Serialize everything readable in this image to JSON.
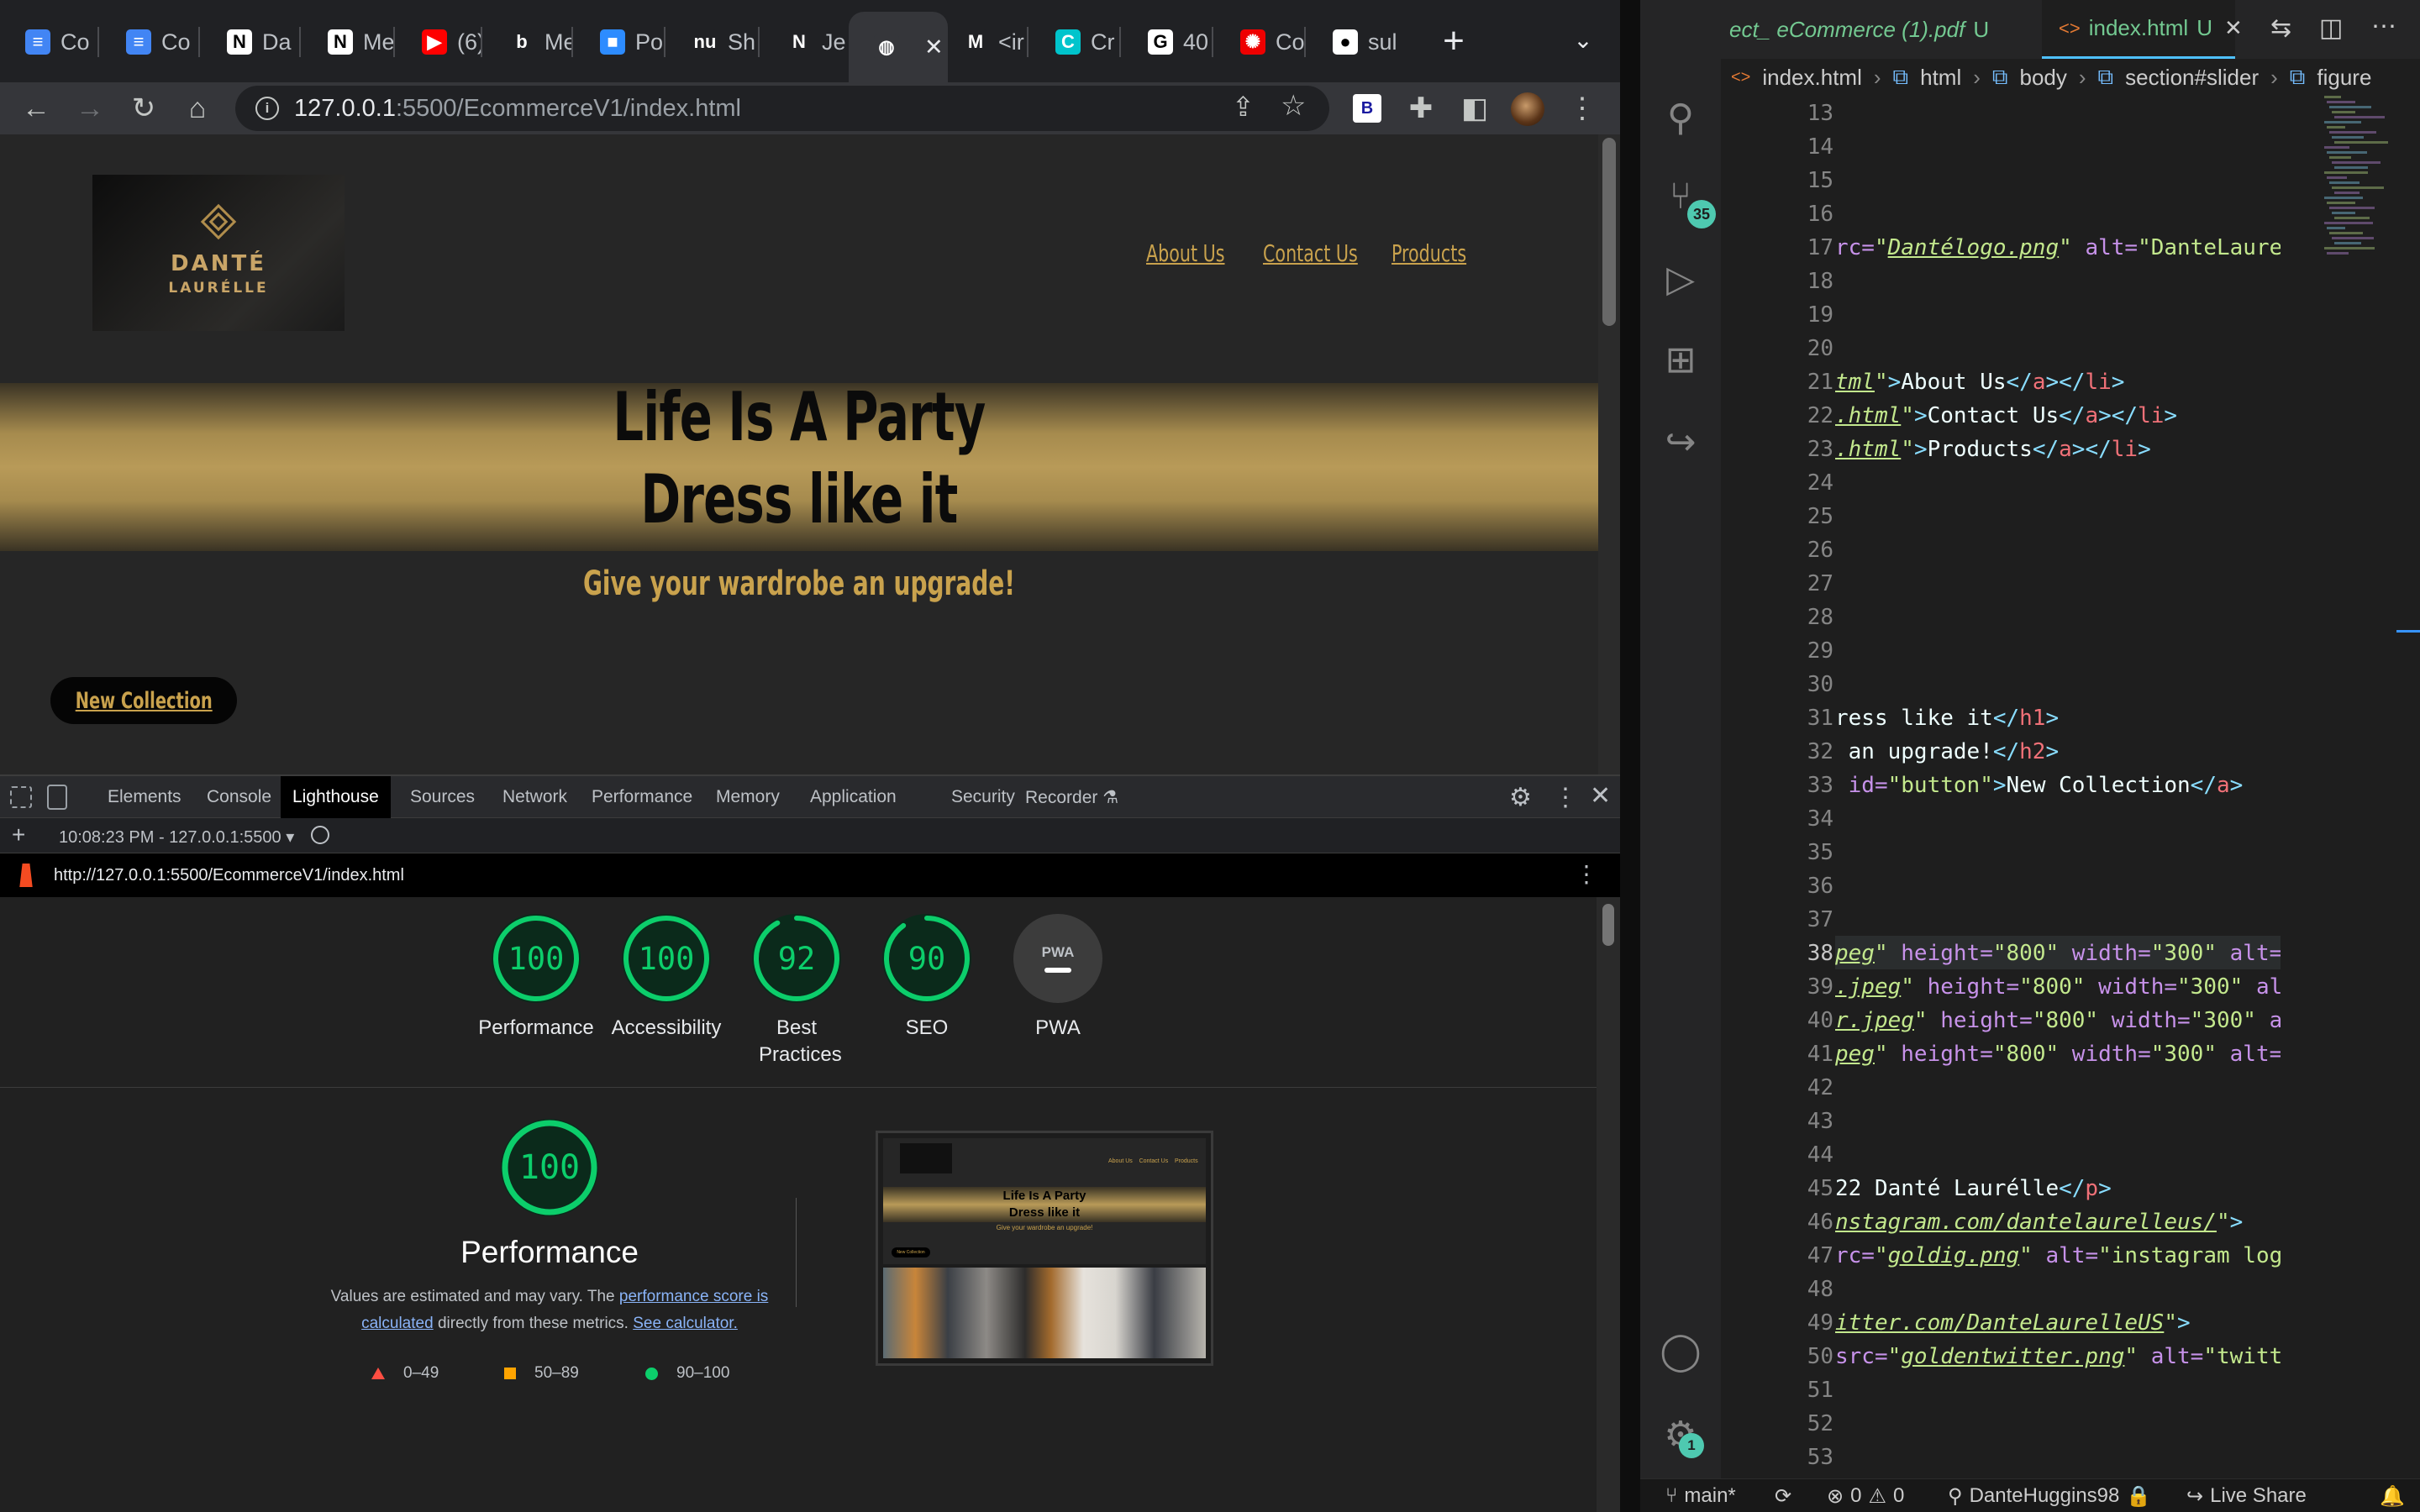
{
  "chrome": {
    "tabs": [
      {
        "label": "Co",
        "icon": "google-docs-icon",
        "color": "#4285f4",
        "glyph": "≡"
      },
      {
        "label": "Co",
        "icon": "google-docs-icon",
        "color": "#4285f4",
        "glyph": "≡"
      },
      {
        "label": "Da",
        "icon": "notion-icon",
        "color": "#ffffff",
        "glyph": "N"
      },
      {
        "label": "Me",
        "icon": "notion-icon",
        "color": "#ffffff",
        "glyph": "N"
      },
      {
        "label": "(6)",
        "icon": "youtube-icon",
        "color": "#ff0000",
        "glyph": "▶"
      },
      {
        "label": "Me",
        "icon": "b-icon",
        "color": "#202124",
        "glyph": "b"
      },
      {
        "label": "Po",
        "icon": "zoom-icon",
        "color": "#2d8cff",
        "glyph": "■"
      },
      {
        "label": "Sh",
        "icon": "nu-icon",
        "color": "#202124",
        "glyph": "nu"
      },
      {
        "label": "Jev",
        "icon": "nm-icon",
        "color": "#202124",
        "glyph": "N"
      },
      {
        "label": "",
        "icon": "globe-icon",
        "color": "#35363a",
        "glyph": "◍",
        "active": true
      },
      {
        "label": "<ir",
        "icon": "m-icon",
        "color": "#202124",
        "glyph": "M"
      },
      {
        "label": "Cr",
        "icon": "canva-icon",
        "color": "#00c4cc",
        "glyph": "C"
      },
      {
        "label": "40",
        "icon": "google-icon",
        "color": "#ffffff",
        "glyph": "G"
      },
      {
        "label": "Co",
        "icon": "redhat-icon",
        "color": "#ee0000",
        "glyph": "✺"
      },
      {
        "label": "sul",
        "icon": "github-icon",
        "color": "#ffffff",
        "glyph": "●"
      }
    ],
    "new_tab": "+",
    "url_host": "127.0.0.1",
    "url_rest": ":5500/EcommerceV1/index.html",
    "extension_b": "B"
  },
  "site": {
    "logo_line1": "DANTÉ",
    "logo_line2": "LAURÉLLE",
    "nav": [
      "About Us",
      "Contact Us",
      "Products"
    ],
    "hero_line1": "Life Is A Party",
    "hero_line2": "Dress like it",
    "subtitle": "Give your wardrobe an upgrade!",
    "cta": "New Collection"
  },
  "devtools": {
    "tabs": [
      "Elements",
      "Console",
      "Lighthouse",
      "Sources",
      "Network",
      "Performance",
      "Memory",
      "Application",
      "Security",
      "Recorder ⚗"
    ],
    "active_tab": "Lighthouse",
    "report_time": "10:08:23 PM - 127.0.0.1:5500 ▾",
    "report_url": "http://127.0.0.1:5500/EcommerceV1/index.html",
    "scores": [
      {
        "label": "Performance",
        "value": "100",
        "fraction": 1.0
      },
      {
        "label": "Accessibility",
        "value": "100",
        "fraction": 1.0
      },
      {
        "label": "Best Practices",
        "value": "92",
        "fraction": 0.92
      },
      {
        "label": "SEO",
        "value": "90",
        "fraction": 0.9
      },
      {
        "label": "PWA",
        "value": "PWA",
        "fraction": 0
      }
    ],
    "perf_score": "100",
    "perf_title": "Performance",
    "perf_desc_1": "Values are estimated and may vary. The ",
    "perf_link_1": "performance score is calculated",
    "perf_desc_2": " directly from these metrics. ",
    "perf_link_2": "See calculator.",
    "legend": [
      "0–49",
      "50–89",
      "90–100"
    ],
    "thumb_hero_1": "Life Is A Party",
    "thumb_hero_2": "Dress like it",
    "thumb_sub": "Give your wardrobe an upgrade!",
    "thumb_cta": "New Collection",
    "thumb_nav": [
      "About Us",
      "Contact Us",
      "Products"
    ]
  },
  "vscode": {
    "tab_pdf": "ect_ eCommerce (1).pdf",
    "tab_pdf_status": "U",
    "tab_html": "index.html",
    "tab_html_status": "U",
    "breadcrumb": [
      "index.html",
      "html",
      "body",
      "section#slider",
      "figure"
    ],
    "scm_badge": "35",
    "settings_badge": "1",
    "current_line": 38,
    "status": {
      "branch": "main*",
      "errors": "0",
      "warnings": "0",
      "user": "DanteHuggins98",
      "live_share": "Live Share"
    }
  }
}
